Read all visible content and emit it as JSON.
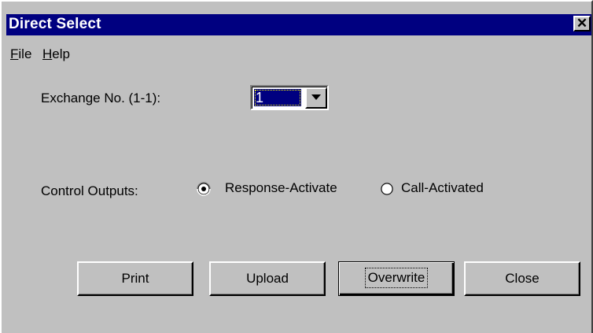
{
  "window": {
    "title": "Direct Select",
    "close_label": "✕"
  },
  "menu": {
    "items": [
      {
        "label_accel": "F",
        "label_rest": "ile"
      },
      {
        "label_accel": "H",
        "label_rest": "elp"
      }
    ]
  },
  "exchange": {
    "label": "Exchange No. (1-1):",
    "selected_value": "1"
  },
  "control_outputs": {
    "label": "Control Outputs:",
    "options": [
      {
        "label": "Response-Activate",
        "checked": true
      },
      {
        "label": "Call-Activated",
        "checked": false
      }
    ]
  },
  "buttons": {
    "print": "Print",
    "upload": "Upload",
    "overwrite": "Overwrite",
    "close": "Close"
  },
  "colors": {
    "titlebar": "#000080",
    "face": "#c0c0c0",
    "selection": "#000080"
  },
  "icons": {
    "close": "close-icon",
    "dropdown": "chevron-down-icon",
    "radio": "radio-icon"
  }
}
